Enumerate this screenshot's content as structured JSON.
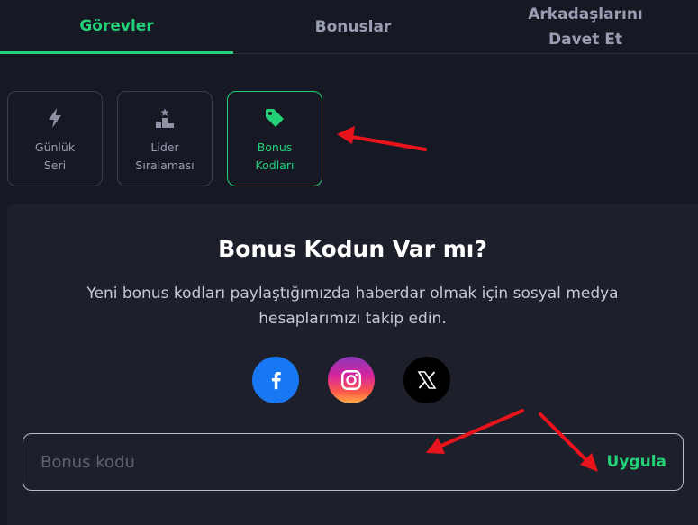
{
  "tabs": [
    {
      "label": "Görevler",
      "active": true
    },
    {
      "label": "Bonuslar",
      "active": false
    },
    {
      "label_line1": "Arkadaşlarını",
      "label_line2": "Davet Et",
      "active": false
    }
  ],
  "subtabs": [
    {
      "line1": "Günlük",
      "line2": "Seri",
      "icon": "lightning-icon",
      "active": false
    },
    {
      "line1": "Lider",
      "line2": "Sıralaması",
      "icon": "podium-icon",
      "active": false
    },
    {
      "line1": "Bonus",
      "line2": "Kodları",
      "icon": "tag-icon",
      "active": true
    }
  ],
  "panel": {
    "title": "Bonus Kodun Var mı?",
    "description": "Yeni bonus kodları paylaştığımızda haberdar olmak için sosyal medya hesaplarımızı takip edin.",
    "socials": [
      "facebook-icon",
      "instagram-icon",
      "x-icon"
    ],
    "code_placeholder": "Bonus kodu",
    "code_value": "",
    "apply_label": "Uygula"
  },
  "colors": {
    "accent": "#22d177",
    "background": "#161824",
    "panel": "#1d1f2b",
    "annotation": "#e8141b"
  }
}
